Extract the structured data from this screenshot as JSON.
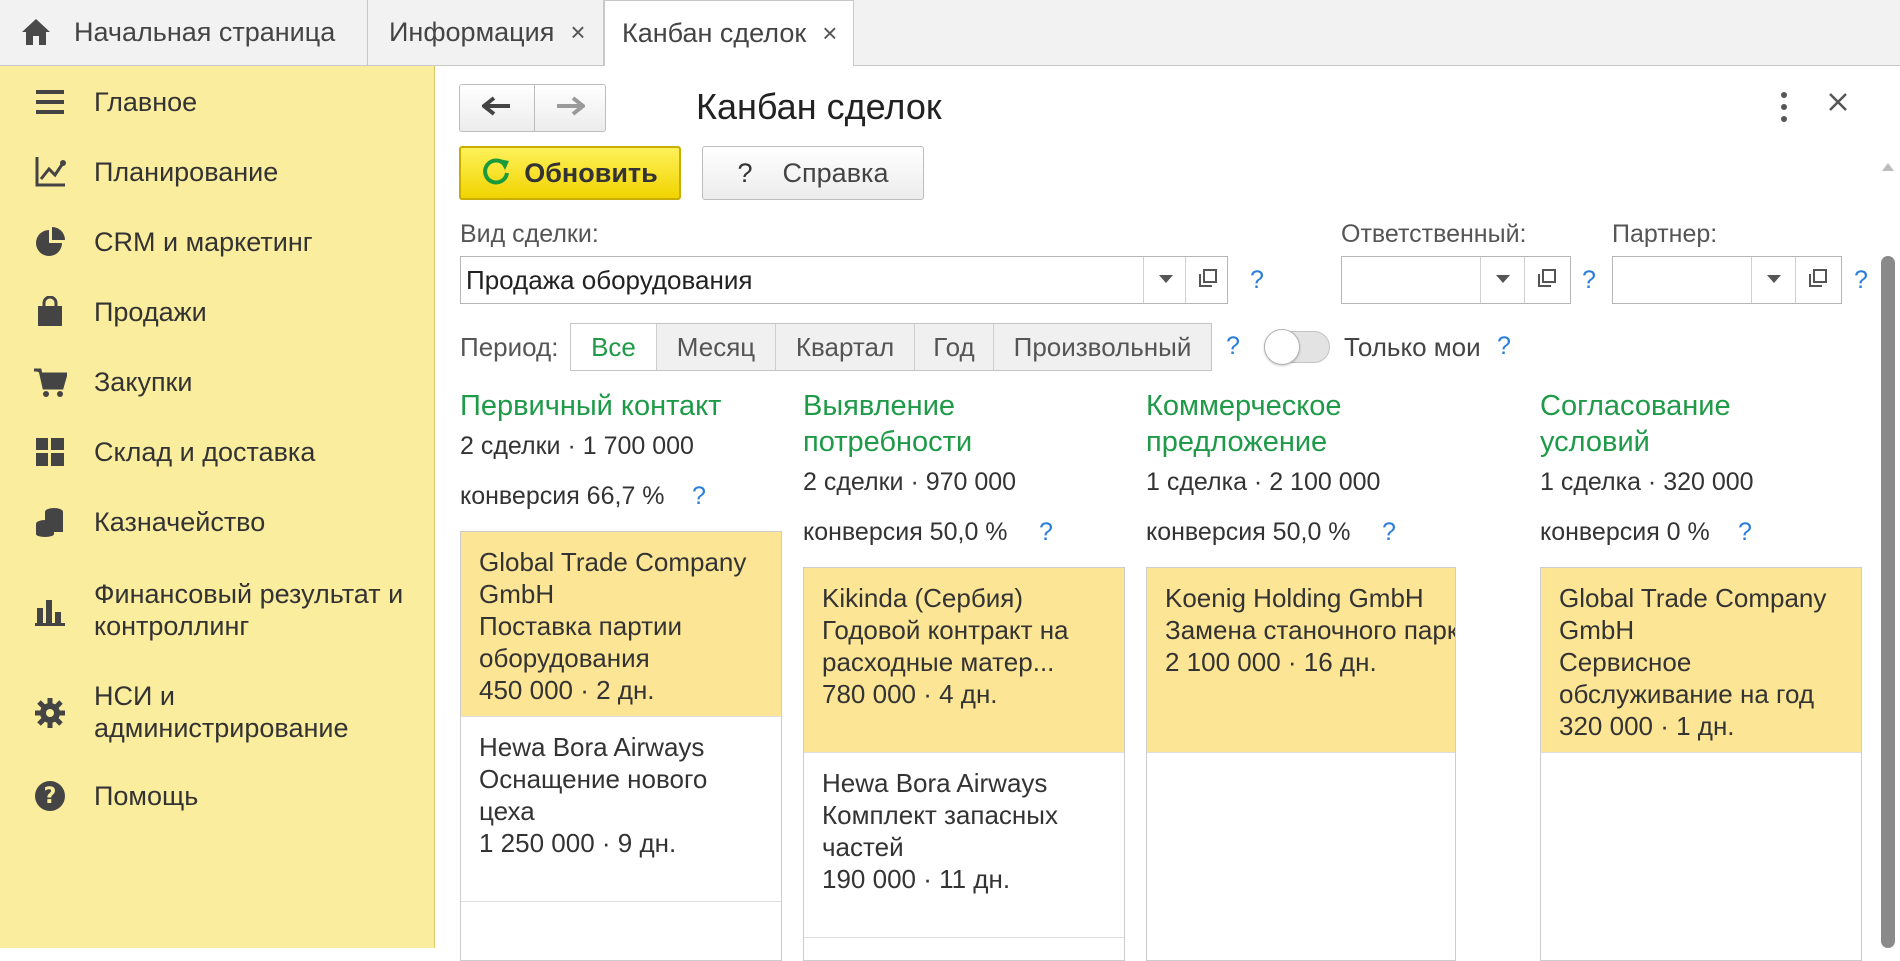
{
  "tabs": [
    {
      "label": "Начальная страница"
    },
    {
      "label": "Информация",
      "close": "×"
    },
    {
      "label": "Канбан сделок",
      "close": "×"
    }
  ],
  "sidebar": {
    "items": [
      {
        "label": "Главное",
        "icon": "menu-icon"
      },
      {
        "label": "Планирование",
        "icon": "planning-icon"
      },
      {
        "label": "CRM и маркетинг",
        "icon": "pie-chart-icon"
      },
      {
        "label": "Продажи",
        "icon": "shopping-bag-icon"
      },
      {
        "label": "Закупки",
        "icon": "cart-icon"
      },
      {
        "label": "Склад и доставка",
        "icon": "warehouse-icon"
      },
      {
        "label": "Казначейство",
        "icon": "coins-icon"
      },
      {
        "label_lines": [
          "Финансовый результат и",
          "контроллинг"
        ],
        "icon": "bar-chart-icon"
      },
      {
        "label_lines": [
          "НСИ и",
          "администрирование"
        ],
        "icon": "gear-icon"
      },
      {
        "label": "Помощь",
        "icon": "help-icon"
      }
    ]
  },
  "form": {
    "title": "Канбан сделок",
    "refresh_label": "Обновить",
    "help_label": "Справка",
    "help_mark": "?",
    "deal_type_label": "Вид сделки:",
    "deal_type_value": "Продажа оборудования",
    "responsible_label": "Ответственный:",
    "responsible_value": "",
    "partner_label": "Партнер:",
    "partner_value": "",
    "hint": "?",
    "period_label": "Период:",
    "periods": [
      "Все",
      "Месяц",
      "Квартал",
      "Год",
      "Произвольный"
    ],
    "period_selected": "Все",
    "only_mine_label": "Только мои",
    "only_mine_on": false
  },
  "columns": [
    {
      "title_lines": [
        "Первичный контакт"
      ],
      "stats": "2 сделки · 1 700 000",
      "conversion": "конверсия 66,7 %",
      "cards": [
        {
          "lines": [
            "Global Trade Company",
            "GmbH",
            "Поставка партии",
            "оборудования",
            "450 000 · 2 дн."
          ],
          "highlighted": true
        },
        {
          "lines": [
            "Hewa Bora Airways",
            "Оснащение нового",
            "цеха",
            "1 250 000 · 9 дн."
          ],
          "highlighted": false
        }
      ]
    },
    {
      "title_lines": [
        "Выявление",
        "потребности"
      ],
      "stats": "2 сделки · 970 000",
      "conversion": "конверсия 50,0 %",
      "cards": [
        {
          "lines": [
            "Kikinda (Сербия)",
            "Годовой контракт на",
            "расходные матер...",
            "780 000 · 4 дн."
          ],
          "highlighted": true
        },
        {
          "lines": [
            "Hewa Bora Airways",
            "Комплект запасных",
            "частей",
            "190 000 · 11 дн."
          ],
          "highlighted": false
        }
      ]
    },
    {
      "title_lines": [
        "Коммерческое",
        "предложение"
      ],
      "stats": "1 сделка · 2 100 000",
      "conversion": "конверсия 50,0 %",
      "cards": [
        {
          "lines": [
            "Koenig Holding GmbH",
            "Замена станочного парка",
            "2 100 000 · 16 дн."
          ],
          "highlighted": true
        }
      ]
    },
    {
      "title_lines": [
        "Согласование",
        "условий"
      ],
      "stats": "1 сделка · 320 000",
      "conversion": "конверсия 0 %",
      "cards": [
        {
          "lines": [
            "Global Trade Company",
            "GmbH",
            "Сервисное",
            "обслуживание на год",
            "320 000 · 1 дн."
          ],
          "highlighted": true
        }
      ]
    }
  ],
  "colors": {
    "sidebar_bg": "#fbed9e",
    "accent_green": "#1f9a48",
    "card_highlight": "#fce594",
    "refresh_button": "#f5d800",
    "hint_blue": "#2a7dd8"
  }
}
